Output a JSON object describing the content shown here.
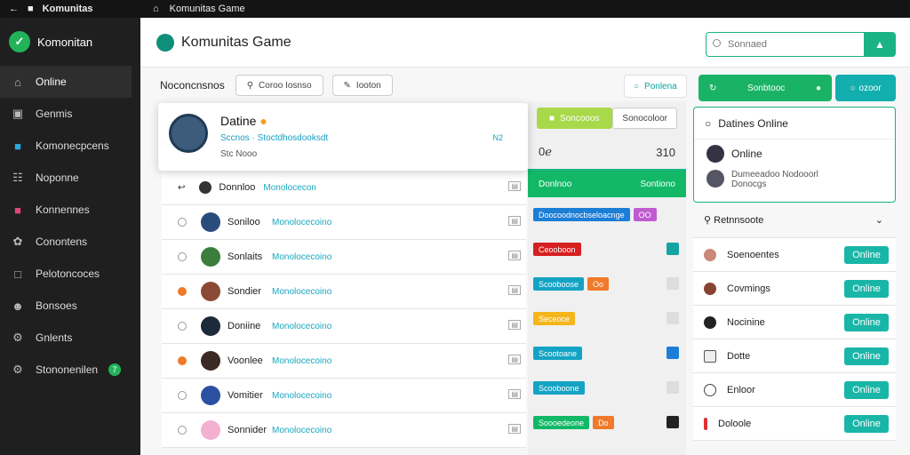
{
  "titlebar": {
    "app_name": "Komunitas",
    "window_title": "Komunitas Game"
  },
  "sidebar": {
    "brand": "Komonitan",
    "items": [
      {
        "label": "Online",
        "icon": "home-icon"
      },
      {
        "label": "Genmis",
        "icon": "folder-icon"
      },
      {
        "label": "Komonecpcens",
        "icon": "chat-icon"
      },
      {
        "label": "Noponne",
        "icon": "list-icon"
      },
      {
        "label": "Konnennes",
        "icon": "bookmark-icon"
      },
      {
        "label": "Conontens",
        "icon": "wrench-icon"
      },
      {
        "label": "Pelotoncoces",
        "icon": "file-icon"
      },
      {
        "label": "Bonsoes",
        "icon": "user-icon"
      },
      {
        "label": "Gnlents",
        "icon": "settings-icon"
      },
      {
        "label": "Stononenilen",
        "icon": "gear-icon",
        "badge": "7"
      }
    ]
  },
  "header": {
    "title": "Komunitas Game",
    "search_placeholder": "Sonnaed"
  },
  "toolbar": {
    "label": "Noconcnsnos",
    "btn1": "Coroo Iosnso",
    "btn2": "Iooton"
  },
  "top_actions": {
    "online_pill": "Ponlena",
    "green_btn": "Sonbtooc",
    "teal_btn": "ozoor"
  },
  "popup": {
    "title": "Datine",
    "line": "Sccnos  ·  Stoctdhosdooksdt",
    "sub": "Stc  Nooo",
    "mark": "N2"
  },
  "table": {
    "rows": [
      {
        "name": "Donnloo",
        "link": "Monolocecon",
        "radio": "arrow",
        "avatar": "#333"
      },
      {
        "name": "Soniloo",
        "link": "Monolocecoino",
        "radio": "empty",
        "avatar": "#2a4c7c"
      },
      {
        "name": "Sonlaits",
        "link": "Monolocecoino",
        "radio": "empty",
        "avatar": "#3b7d3a"
      },
      {
        "name": "Sondier",
        "link": "Monolocecoino",
        "radio": "orange",
        "avatar": "#8a4a35"
      },
      {
        "name": "Doniine",
        "link": "Monolocecoino",
        "radio": "empty",
        "avatar": "#1d2a3a"
      },
      {
        "name": "Voonlee",
        "link": "Monolocecoino",
        "radio": "orange",
        "avatar": "#3a2a24"
      },
      {
        "name": "Vomitier",
        "link": "Monolocecoino",
        "radio": "empty",
        "avatar": "#2b50a0"
      },
      {
        "name": "Sonnider",
        "link": "Monolocecoino",
        "radio": "empty",
        "avatar": "#f4b0d0"
      }
    ]
  },
  "mid": {
    "head_btn1": "Soncooos",
    "head_btn2": "Sonocoloor",
    "count_left": "0ℯ",
    "count_right": "310",
    "green_left": "Donlnoo",
    "green_right": "Sontiono",
    "rows": [
      {
        "tags": [
          {
            "t": "Doocoodnocbseloacnge",
            "c": "#1c7ed6"
          },
          {
            "t": "OO",
            "c": "#c05bd0"
          }
        ],
        "sq": ""
      },
      {
        "tags": [
          {
            "t": "Ceooboon",
            "c": "#d62020"
          }
        ],
        "sq": "#14a3a3"
      },
      {
        "tags": [
          {
            "t": "Scooboose",
            "c": "#14a3c4"
          },
          {
            "t": "Oo",
            "c": "#f07a2a"
          }
        ],
        "sq": "#ddd"
      },
      {
        "tags": [
          {
            "t": "Seceoce",
            "c": "#f5b51b"
          }
        ],
        "sq": "#ddd"
      },
      {
        "tags": [
          {
            "t": "Scootoane",
            "c": "#14a3c4"
          }
        ],
        "sq": "#1c7ed6"
      },
      {
        "tags": [
          {
            "t": "Scooboone",
            "c": "#14a3c4"
          }
        ],
        "sq": "#ddd"
      },
      {
        "tags": [
          {
            "t": "Soooedeone",
            "c": "#12b866"
          },
          {
            "t": "Do",
            "c": "#f07a2a"
          }
        ],
        "sq": "#222"
      }
    ]
  },
  "right": {
    "card_title": "Datines Online",
    "card_row1": "Online",
    "card_row2": "Dumeeadoo  Nodooorl",
    "card_row2_sub": "Donocgs",
    "list_head": "Retnnsoote",
    "rows": [
      {
        "name": "Soenoentes",
        "btn": "Online"
      },
      {
        "name": "Covmings",
        "btn": "Online"
      },
      {
        "name": "Nocinine",
        "btn": "Online"
      },
      {
        "name": "Dotte",
        "btn": "Online"
      },
      {
        "name": "Enloor",
        "btn": "Online"
      },
      {
        "name": "Doloole",
        "btn": "Online"
      }
    ]
  },
  "colors": {
    "accent": "#1ab386",
    "sidebar_bg": "#1f1f1f"
  }
}
